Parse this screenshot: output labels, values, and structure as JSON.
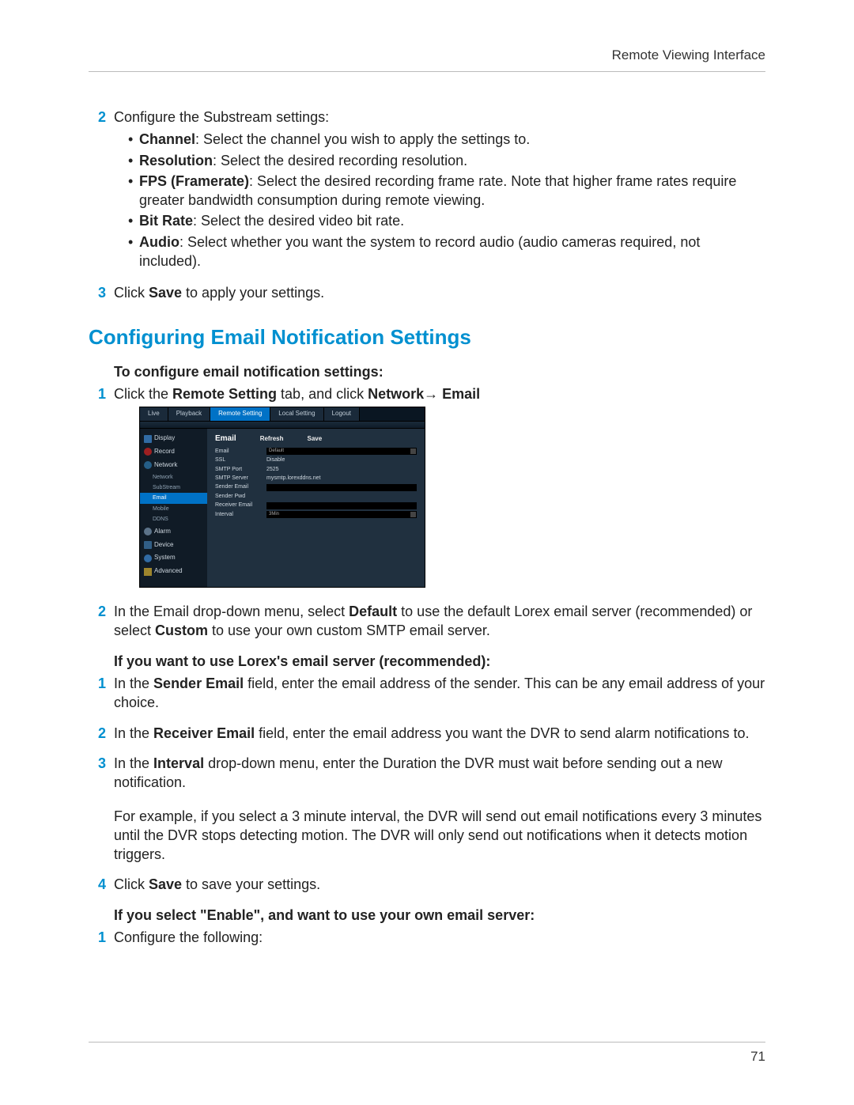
{
  "header": {
    "title": "Remote Viewing Interface"
  },
  "footer": {
    "page_number": "71"
  },
  "section2": {
    "num": "2",
    "intro": "Configure the Substream settings:",
    "bullets": [
      {
        "label": "Channel",
        "text": ": Select the channel you wish to apply the settings to."
      },
      {
        "label": "Resolution",
        "text": ": Select the desired recording resolution."
      },
      {
        "label": "FPS (Framerate)",
        "text": ": Select the desired recording frame rate. Note that higher frame rates require greater bandwidth consumption during remote viewing."
      },
      {
        "label": "Bit Rate",
        "text": ": Select the desired video bit rate."
      },
      {
        "label": "Audio",
        "text": ": Select whether you want the system to record audio (audio cameras required, not included)."
      }
    ]
  },
  "section3": {
    "num": "3",
    "pre": " Click ",
    "bold": "Save",
    "post": " to apply your settings."
  },
  "title": "Configuring Email Notification Settings",
  "sub1": "To configure email notification settings:",
  "step1": {
    "num": "1",
    "pre": "Click the ",
    "b1": "Remote Setting",
    "mid": " tab, and click ",
    "b2": "Network",
    "arrow": "→ ",
    "b3": "Email"
  },
  "stepA2": {
    "num": "2",
    "pre": "In the Email drop-down menu, select ",
    "b1": "Default",
    "mid": " to use the default Lorex email server (recommended) or select ",
    "b2": "Custom",
    "post": " to use your own custom SMTP email server."
  },
  "sub2": "If you want to use Lorex's email server (recommended):",
  "lorex": {
    "s1": {
      "num": "1",
      "pre": "In the ",
      "b": "Sender Email",
      "post": " field, enter the email address of the sender. This can be any email address of your choice."
    },
    "s2": {
      "num": "2",
      "pre": "In the ",
      "b": "Receiver Email",
      "post": " field, enter the email address you want the DVR to send alarm notifications to."
    },
    "s3": {
      "num": "3",
      "pre": "In the ",
      "b": "Interval",
      "post": " drop-down menu, enter the Duration the DVR must wait before sending out a new notification.",
      "example": "For example, if you select a 3 minute interval, the DVR will send out email notifications every 3 minutes until the DVR stops detecting motion. The DVR will only send out notifications when it detects motion triggers."
    },
    "s4": {
      "num": "4",
      "pre": "Click ",
      "b": "Save",
      "post": " to save your settings."
    }
  },
  "sub3": "If you select \"Enable\", and want to use your own email server:",
  "own": {
    "s1": {
      "num": "1",
      "text": "Configure the following:"
    }
  },
  "screenshot": {
    "tabs": {
      "live": "Live",
      "playback": "Playback",
      "remote": "Remote Setting",
      "local": "Local Setting",
      "logout": "Logout"
    },
    "sidebar": {
      "display": "Display",
      "record": "Record",
      "network": "Network",
      "network_sub": {
        "network": "Network",
        "substream": "SubStream",
        "email": "Email",
        "mobile": "Mobile",
        "ddns": "DDNS"
      },
      "alarm": "Alarm",
      "device": "Device",
      "system": "System",
      "advanced": "Advanced"
    },
    "panel": {
      "title": "Email",
      "refresh": "Refresh",
      "save": "Save",
      "rows": {
        "email": {
          "label": "Email",
          "value": "Default"
        },
        "ssl": {
          "label": "SSL",
          "value": "Disable"
        },
        "smtp_port": {
          "label": "SMTP Port",
          "value": "2525"
        },
        "smtp_server": {
          "label": "SMTP Server",
          "value": "mysmtp.lorexddns.net"
        },
        "sender_email": {
          "label": "Sender Email",
          "value": ""
        },
        "sender_pwd": {
          "label": "Sender Pwd",
          "value": ""
        },
        "receiver_email": {
          "label": "Receiver Email",
          "value": ""
        },
        "interval": {
          "label": "Interval",
          "value": "3Min"
        }
      }
    }
  }
}
